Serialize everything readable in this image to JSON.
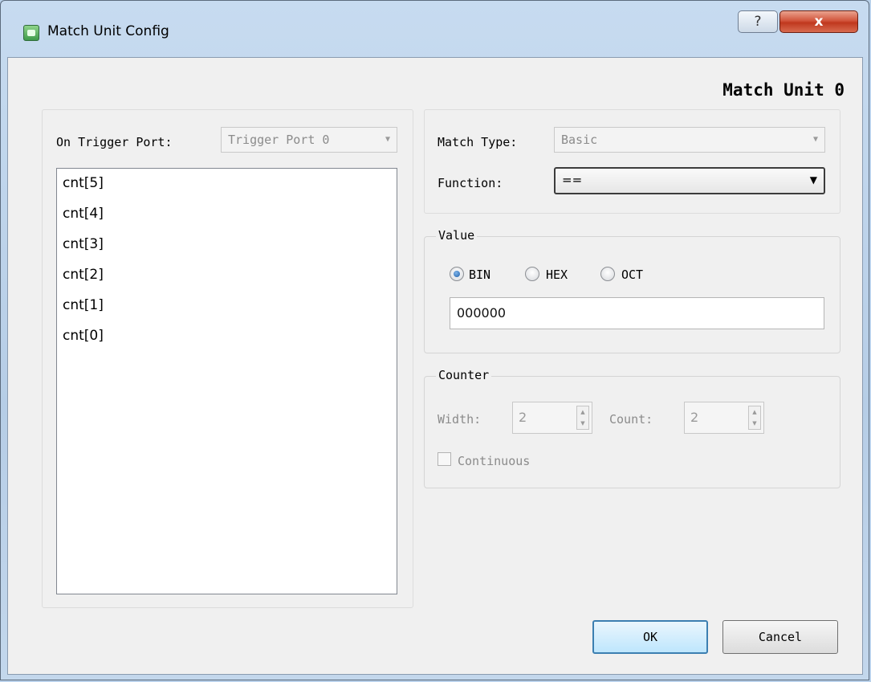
{
  "window": {
    "title": "Match Unit Config",
    "help_glyph": "?",
    "close_glyph": "x"
  },
  "heading": "Match Unit 0",
  "trigger": {
    "label": "On Trigger Port:",
    "port_value": "Trigger Port 0",
    "signals": [
      "cnt[5]",
      "cnt[4]",
      "cnt[3]",
      "cnt[2]",
      "cnt[1]",
      "cnt[0]"
    ]
  },
  "match": {
    "type_label": "Match Type:",
    "type_value": "Basic",
    "function_label": "Function:",
    "function_value": "=="
  },
  "value": {
    "group_label": "Value",
    "radix_options": [
      "BIN",
      "HEX",
      "OCT"
    ],
    "selected_radix": "BIN",
    "text": "000000"
  },
  "counter": {
    "group_label": "Counter",
    "width_label": "Width:",
    "width_value": "2",
    "count_label": "Count:",
    "count_value": "2",
    "continuous_label": "Continuous"
  },
  "buttons": {
    "ok": "OK",
    "cancel": "Cancel"
  },
  "icons": {
    "dropdown_arrow": "▼",
    "spin_up": "▲",
    "spin_down": "▼"
  }
}
